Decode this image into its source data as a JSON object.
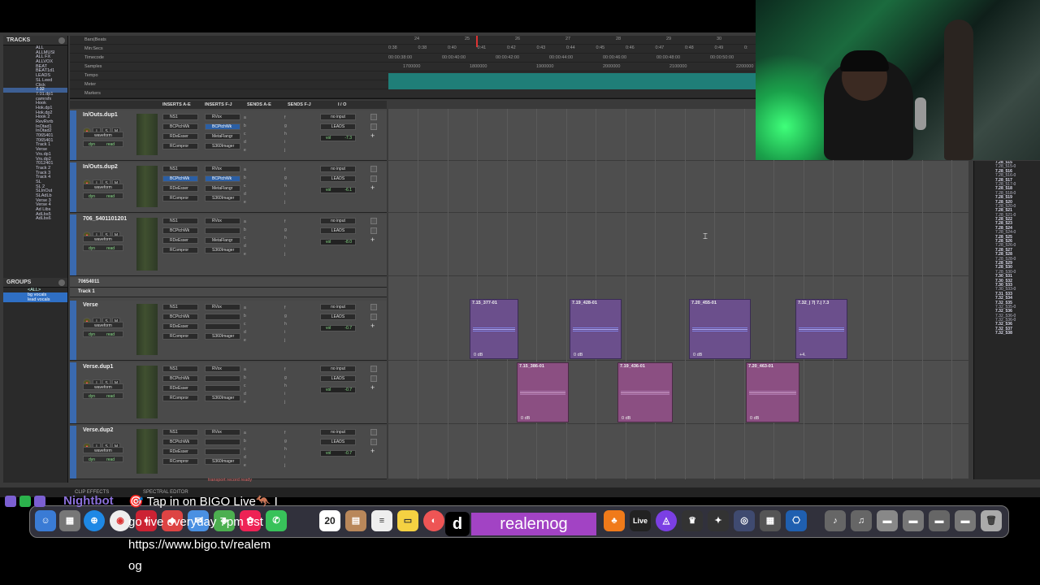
{
  "colors": {
    "accent_blue": "#3d5f94",
    "marker": "#1f7e78",
    "clip_blue": "#6b4f8c",
    "clip_pink": "#8b4f82",
    "tiktok": "#a243c4",
    "nightbot": "#8a6fd8"
  },
  "left_panel": {
    "tracks_title": "TRACKS",
    "tracks": [
      "ALL",
      "ALLMUSI",
      "ALL FX",
      "ALLVOX",
      "BEAT",
      "BEAT1d1",
      "LEADS",
      "SL Leed",
      "Click",
      "7.32",
      "7.01.dp1",
      "camrsfx",
      "Hook",
      "Hok.dp1",
      "Hok.dp2",
      "Hook 2",
      "RevRvrb",
      "InOtad1",
      "InOtad2",
      "7065401",
      "7065401",
      "Track 1",
      "Verse",
      "Vrs.dp1",
      "Vrs.dp2",
      "7012401",
      "Track 2",
      "Track 3",
      "Track 4",
      "SL",
      "SL 2",
      "SLInOut",
      "SLAdLb",
      "Verse 3",
      "Verse 4",
      "Ad Libs",
      "AdLbs5",
      "AdLbs6"
    ],
    "selected_track": "7.32",
    "groups_title": "GROUPS",
    "groups": [
      "<ALL>",
      "bg vocals",
      "lead vocals"
    ]
  },
  "rulers": {
    "rows": [
      "Bars|Beats",
      "Min:Secs",
      "Timecode",
      "Samples",
      "Tempo",
      "Meter",
      "Markers"
    ],
    "bar_ticks": [
      "24",
      "25",
      "26",
      "27",
      "28",
      "29",
      "30"
    ],
    "sec_ticks": [
      "0:38",
      "0:38",
      "0:40",
      "0:41",
      "0:42",
      "0:43",
      "0:44",
      "0:45",
      "0:46",
      "0:47",
      "0:48",
      "0:49",
      "0:"
    ],
    "tc_ticks": [
      "00:00:38:00",
      "00:00:40:00",
      "00:00:42:00",
      "00:00:44:00",
      "00:00:46:00",
      "00:00:48:00",
      "00:00:50:00"
    ],
    "sample_ticks": [
      "1700000",
      "1800000",
      "1900000",
      "2000000",
      "2100000",
      "2200000"
    ]
  },
  "col_headers": {
    "inserts_ae": "INSERTS A-E",
    "inserts_fj": "INSERTS F-J",
    "sends_ae": "SENDS A-E",
    "sends_fj": "SENDS F-J",
    "io": "I / O"
  },
  "tracks": [
    {
      "name": "In/Outs.dup1",
      "inserts_ae": [
        "NS1",
        "BCPtchWk",
        "RDeEsser",
        "RCompror"
      ],
      "inserts_fj": [
        "RVox",
        "BCPtchWk",
        "MetaFlangr",
        "S360Imager"
      ],
      "sends": [
        "a",
        "b",
        "c",
        "d",
        "e"
      ],
      "sends2": [
        "f",
        "g",
        "h",
        "i",
        "j"
      ],
      "input": "no input",
      "output": "LEADS",
      "vol": "-7.3",
      "wf": "waveform",
      "dyn": "dyn",
      "read": "read"
    },
    {
      "name": "In/Outs.dup2",
      "inserts_ae": [
        "NS1",
        "BCPtchWk",
        "RDeEsser",
        "RCompror"
      ],
      "inserts_fj": [
        "RVox",
        "BCPtchWk",
        "MetaFlangr",
        "S360Imager"
      ],
      "sends": [
        "a",
        "b",
        "c",
        "d",
        "e"
      ],
      "sends2": [
        "f",
        "g",
        "h",
        "i",
        "j"
      ],
      "input": "no input",
      "output": "LEADS",
      "vol": "-6.1",
      "wf": "waveform",
      "dyn": "dyn",
      "read": "read"
    },
    {
      "name": "706_5401101201",
      "inserts_ae": [
        "NS1",
        "BCPtchWk",
        "RDeEsser",
        "RCompror"
      ],
      "inserts_fj": [
        "RVox",
        "",
        "MetaFlangr",
        "S360Imager"
      ],
      "sends": [
        "a",
        "b",
        "c",
        "d",
        "e"
      ],
      "sends2": [
        "f",
        "g",
        "h",
        "i",
        "j"
      ],
      "input": "no input",
      "output": "LEADS",
      "vol": "-8.0",
      "wf": "waveform",
      "dyn": "dyn",
      "read": "read"
    },
    {
      "name": "Verse",
      "inserts_ae": [
        "NS1",
        "BCPtchWk",
        "RDeEsser",
        "RCompror"
      ],
      "inserts_fj": [
        "RVox",
        "",
        "",
        "S360Imager"
      ],
      "sends": [
        "a",
        "b",
        "c",
        "d",
        "e"
      ],
      "sends2": [
        "f",
        "g",
        "h",
        "i",
        "j"
      ],
      "input": "no input",
      "output": "LEADS",
      "vol": "-0.7",
      "wf": "waveform",
      "dyn": "dyn",
      "read": "read"
    },
    {
      "name": "Verse.dup1",
      "inserts_ae": [
        "NS1",
        "BCPtchWk",
        "RDeEsser",
        "RCompror"
      ],
      "inserts_fj": [
        "RVox",
        "",
        "",
        "S360Imager"
      ],
      "sends": [
        "a",
        "b",
        "c",
        "d",
        "e"
      ],
      "sends2": [
        "f",
        "g",
        "h",
        "i",
        "j"
      ],
      "input": "no input",
      "output": "LEADS",
      "vol": "-0.7",
      "wf": "waveform",
      "dyn": "dyn",
      "read": "read"
    },
    {
      "name": "Verse.dup2",
      "inserts_ae": [
        "NS1",
        "BCPtchWk",
        "RDeEsser",
        "RCompror"
      ],
      "inserts_fj": [
        "RVox",
        "",
        "",
        "S360Imager"
      ],
      "sends": [
        "a",
        "b",
        "c",
        "d",
        "e"
      ],
      "sends2": [
        "f",
        "g",
        "h",
        "i",
        "j"
      ],
      "input": "no input",
      "output": "LEADS",
      "vol": "-0.7",
      "wf": "waveform",
      "dyn": "dyn",
      "read": "read"
    }
  ],
  "folder_rows": [
    {
      "name": "70654011"
    },
    {
      "name": "Track 1"
    }
  ],
  "clips_verse": [
    {
      "name": "7.15_377-01",
      "db": "0 dB"
    },
    {
      "name": "7.19_428-01",
      "db": "0 dB"
    },
    {
      "name": "7.20_455-01",
      "db": "0 dB"
    },
    {
      "name": "7.32_| 7| 7.| 7.3",
      "db": "+4."
    }
  ],
  "clips_verse_dup1": [
    {
      "name": "7.15_386-01",
      "db": "0 dB"
    },
    {
      "name": "7.19_436-01",
      "db": "0 dB"
    },
    {
      "name": "7.20_463-01",
      "db": "0 dB"
    }
  ],
  "right_list": [
    "7.28_515",
    "7.28_515-0",
    "7.28_516",
    "7.28_516-0",
    "7.28_517",
    "7.28_517-0",
    "7.28_518",
    "7.28_518-0",
    "7.28_519",
    "7.28_520",
    "7.28_520-0",
    "7.28_521",
    "7.28_521-0",
    "7.28_522",
    "7.28_523",
    "7.28_524",
    "7.28_524-0",
    "7.28_525",
    "7.28_526",
    "7.28_526-0",
    "7.28_527",
    "7.28_528",
    "7.28_528-0",
    "7.28_529",
    "7.28_530",
    "7.28_530-0",
    "7.30_531",
    "7.30_532",
    "7.30_533",
    "7.30_533-0",
    "7.31_533",
    "7.32_534",
    "7.32_535",
    "7.32_535-0",
    "7.32_536",
    "7.32_536-0",
    "7.32_536-0",
    "7.32_536",
    "7.32_537",
    "7.32_538"
  ],
  "bottom_bar": {
    "clip_effects": "CLIP EFFECTS",
    "spectral": "SPECTRAL EDITOR",
    "transport": "transport record ready"
  },
  "chat": {
    "user": "Nightbot",
    "line1": "🎯 Tap in on BIGO Live🦘 I",
    "line2": "go live everyday 7pm est",
    "line3": "https://www.bigo.tv/realem",
    "line4": "og"
  },
  "handle": {
    "name": "realemog",
    "logo": "d"
  },
  "dock": {
    "calendar_day": "20",
    "live_label": "Live"
  }
}
